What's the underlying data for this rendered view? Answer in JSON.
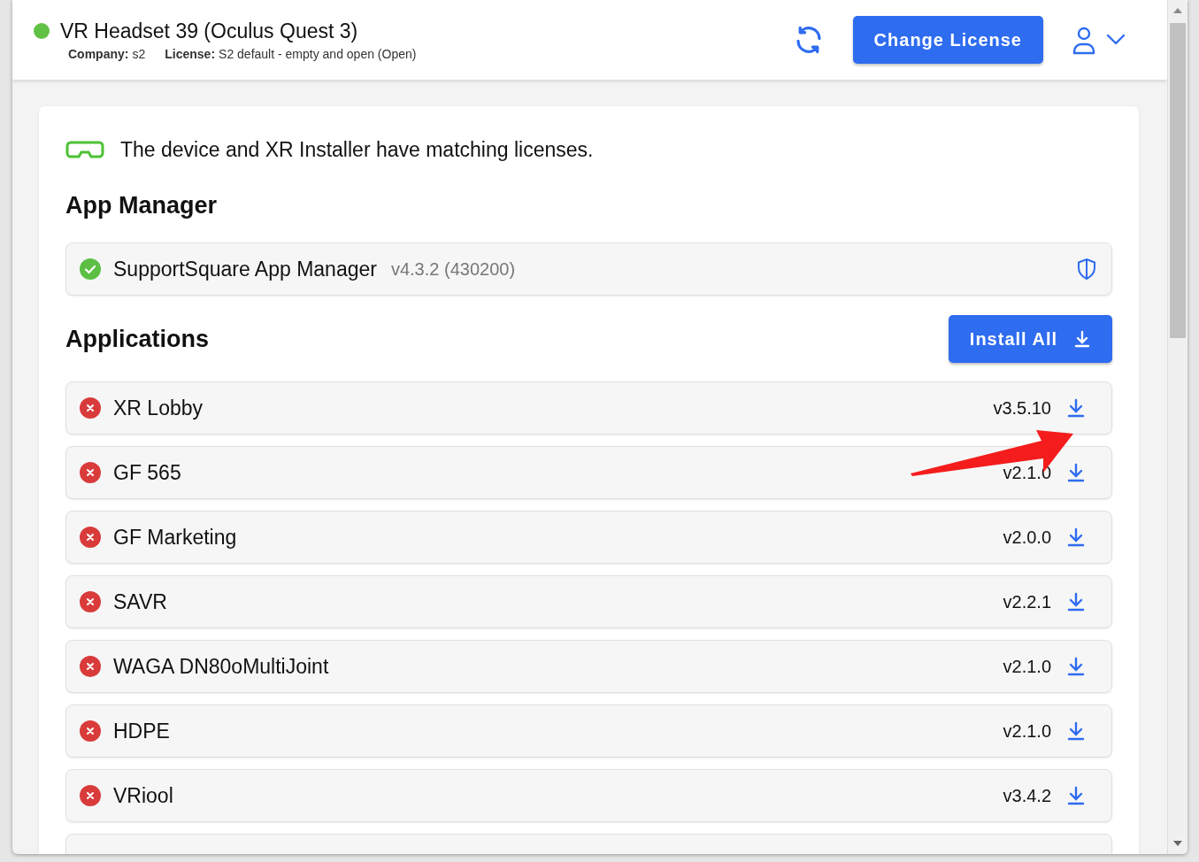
{
  "header": {
    "device_name": "VR Headset 39 (Oculus Quest 3)",
    "online": true,
    "company_label": "Company:",
    "company": "s2",
    "license_label": "License:",
    "license": "S2 default - empty and open (Open)",
    "change_license_button": "Change License"
  },
  "license_notice": {
    "text": "The device and XR Installer have matching licenses.",
    "matching": true
  },
  "app_manager": {
    "title": "App Manager",
    "name": "SupportSquare App Manager",
    "version": "v4.3.2 (430200)",
    "installed": true
  },
  "applications": {
    "title": "Applications",
    "install_all_button": "Install All",
    "items": [
      {
        "name": "XR Lobby",
        "version": "v3.5.10",
        "installed": false
      },
      {
        "name": "GF 565",
        "version": "v2.1.0",
        "installed": false
      },
      {
        "name": "GF Marketing",
        "version": "v2.0.0",
        "installed": false
      },
      {
        "name": "SAVR",
        "version": "v2.2.1",
        "installed": false
      },
      {
        "name": "WAGA DN80oMultiJoint",
        "version": "v2.1.0",
        "installed": false
      },
      {
        "name": "HDPE",
        "version": "v2.1.0",
        "installed": false
      },
      {
        "name": "VRiool",
        "version": "v3.4.2",
        "installed": false
      }
    ]
  }
}
